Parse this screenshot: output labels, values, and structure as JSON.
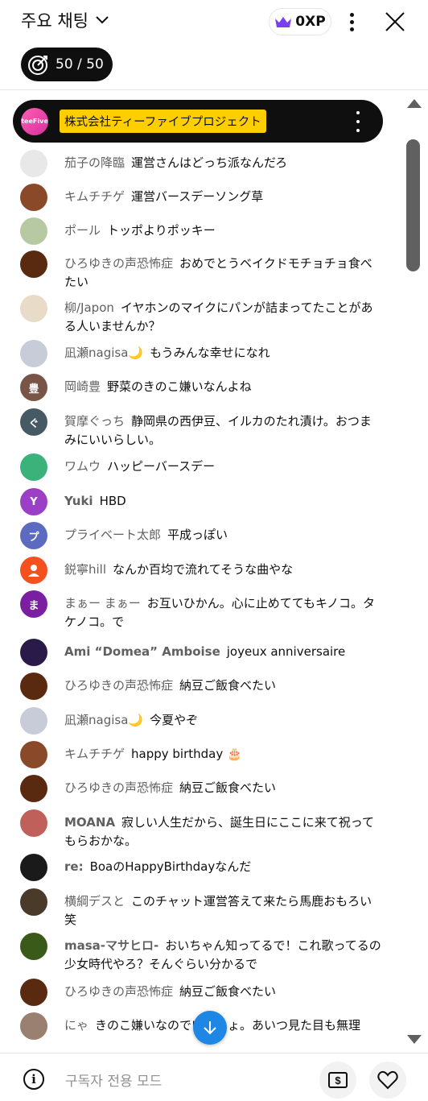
{
  "header": {
    "title": "주요 채팅",
    "xp_label": "0XP",
    "goal_label": "50 / 50"
  },
  "pinned": {
    "logo_text": "teeFive",
    "label": "株式会社ティーファイブプロジェクト"
  },
  "messages": [
    {
      "author": "茄子の降臨",
      "text": "運営さんはどっち派なんだろ",
      "avatar_color": "#d8d8d8"
    },
    {
      "author": "キムチチゲ",
      "text": "運営バースデーソング草",
      "avatar_color": "#8a4a2a"
    },
    {
      "author": "ポール",
      "text": "トッポよりポッキー",
      "avatar_color": "#b7c9a3"
    },
    {
      "author": "ひろゆきの声恐怖症",
      "text": "おめでとうベイクドモチョチョ食べたい",
      "avatar_color": "#5a2a10"
    },
    {
      "author": "柳/Japon",
      "text": "イヤホンのマイクにパンが詰まってたことがある人いませんか？",
      "avatar_color": "#e8dcc8"
    },
    {
      "author": "凪瀬nagisa🌙",
      "text": "もうみんな幸せになれ",
      "avatar_color": "#c8ccd8"
    },
    {
      "author": "岡崎豊",
      "text": "野菜のきのこ嫌いなんよね",
      "avatar_color": "#795548",
      "initial": "豊"
    },
    {
      "author": "賀摩ぐっち",
      "text": "静岡県の西伊豆、イルカのたれ漬け。おつまみにいいらしい。",
      "avatar_color": "#455a64",
      "initial": "ぐ"
    },
    {
      "author": "ワムウ",
      "text": "ハッピーバースデー",
      "avatar_color": "#3ab27a"
    },
    {
      "author": "Yuki",
      "text": "HBD",
      "avatar_color": "#9c3fc7",
      "initial": "Y"
    },
    {
      "author": "プライベート太郎",
      "text": "平成っぽい",
      "avatar_color": "#5c6bc0",
      "initial": "プ"
    },
    {
      "author": "鋭寧hill",
      "text": "なんか百均で流れてそうな曲やな",
      "avatar_color": "#f4511e"
    },
    {
      "author": "まぁー まぁー",
      "text": "お互いひかん。心に止めててもキノコ。タケノコ。で",
      "avatar_color": "#7b1fa2",
      "initial": "ま"
    },
    {
      "author": "Ami “Domea” Amboise",
      "text": "joyeux anniversaire",
      "avatar_color": "#2a1a4a"
    },
    {
      "author": "ひろゆきの声恐怖症",
      "text": "納豆ご飯食べたい",
      "avatar_color": "#5a2a10"
    },
    {
      "author": "凪瀬nagisa🌙",
      "text": "今夏やぞ",
      "avatar_color": "#c8ccd8"
    },
    {
      "author": "キムチチゲ",
      "text": "happy birthday 🎂",
      "avatar_color": "#8a4a2a"
    },
    {
      "author": "ひろゆきの声恐怖症",
      "text": "納豆ご飯食べたい",
      "avatar_color": "#5a2a10"
    },
    {
      "author": "MOANA",
      "text": "寂しい人生だから、誕生日にここに来て祝ってもらおかな。",
      "avatar_color": "#c0605a"
    },
    {
      "author": "re:",
      "text": "BoaのHappyBirthdayなんだ",
      "avatar_color": "#1a1a1a"
    },
    {
      "author": "横綱デスと",
      "text": "このチャット運営答えて来たら馬鹿おもろい笑",
      "avatar_color": "#4a3a2a"
    },
    {
      "author": "masa-マサヒロ-",
      "text": "おいちゃん知ってるで！これ歌ってるの少女時代やろ？そんぐらい分かるで",
      "avatar_color": "#3a5a1a"
    },
    {
      "author": "ひろゆきの声恐怖症",
      "text": "納豆ご飯食べたい",
      "avatar_color": "#5a2a10"
    },
    {
      "author": "にゃ",
      "text": "きのこ嫌いなのでいっしょ。あいつ見た目も無理",
      "avatar_color": "#9a8070"
    }
  ],
  "footer": {
    "placeholder": "구독자 전용 모드"
  }
}
